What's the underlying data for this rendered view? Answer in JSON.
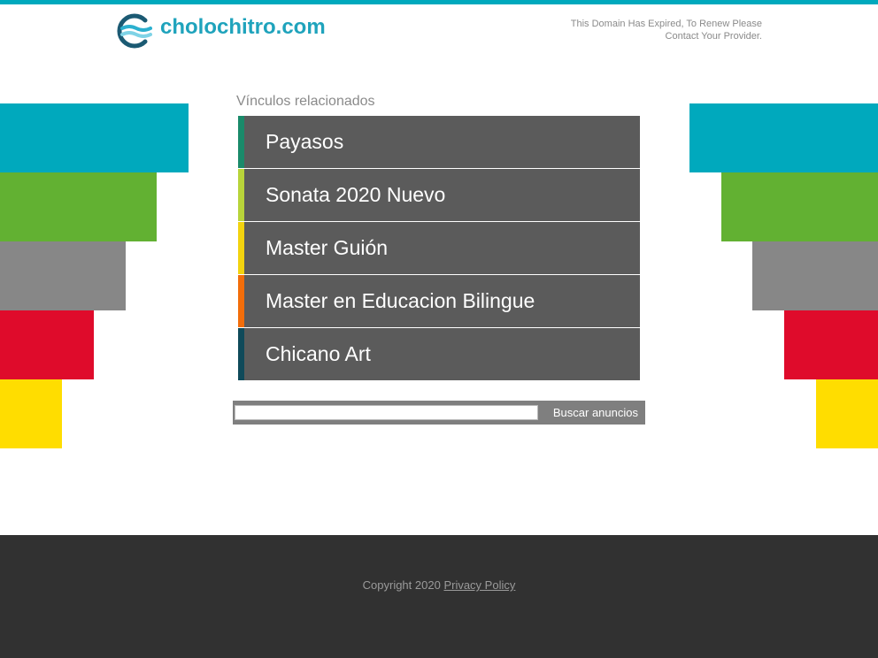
{
  "header": {
    "domain": "cholochitro.com",
    "notice_line1": "This Domain Has Expired, To Renew Please",
    "notice_line2": "Contact Your Provider."
  },
  "colors": {
    "top_bar": "#00a9bd",
    "bars": [
      "#00a9bd",
      "#62b132",
      "#878787",
      "#df0b2b",
      "#ffdd00"
    ],
    "link_bg": "#5b5b5b",
    "footer_bg": "#313131"
  },
  "related": {
    "title": "Vínculos relacionados",
    "links": [
      {
        "label": "Payasos",
        "accent": "#1a8a6a"
      },
      {
        "label": "Sonata 2020 Nuevo",
        "accent": "#b8d43a"
      },
      {
        "label": "Master Guión",
        "accent": "#f2d30f"
      },
      {
        "label": "Master en Educacion Bilingue",
        "accent": "#f26d0a"
      },
      {
        "label": "Chicano Art",
        "accent": "#0f4a5a"
      }
    ]
  },
  "search": {
    "value": "",
    "button_label": "Buscar anuncios"
  },
  "footer": {
    "copyright": "Copyright 2020",
    "privacy_label": "Privacy Policy"
  }
}
